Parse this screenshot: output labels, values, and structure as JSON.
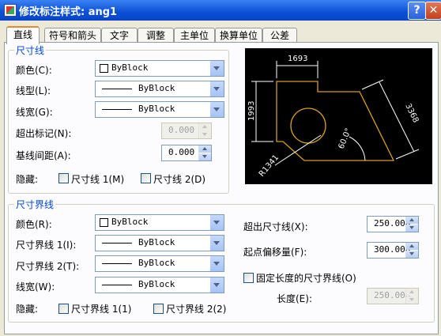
{
  "window": {
    "title": "修改标注样式: ang1",
    "help_glyph": "?",
    "close_glyph": "✕"
  },
  "tabs": [
    "直线",
    "符号和箭头",
    "文字",
    "调整",
    "主单位",
    "换算单位",
    "公差"
  ],
  "dim_lines": {
    "group_label": "尺寸线",
    "color_label": "颜色(C):",
    "color_value": "ByBlock",
    "linetype_label": "线型(L):",
    "linetype_value": "ByBlock",
    "lineweight_label": "线宽(G):",
    "lineweight_value": "ByBlock",
    "extend_ticks_label": "超出标记(N):",
    "extend_ticks_value": "0.000",
    "baseline_spacing_label": "基线间距(A):",
    "baseline_spacing_value": "0.000",
    "suppress_label": "隐藏:",
    "suppress_1": "尺寸线 1(M)",
    "suppress_2": "尺寸线 2(D)"
  },
  "ext_lines": {
    "group_label": "尺寸界线",
    "color_label": "颜色(R):",
    "color_value": "ByBlock",
    "linetype1_label": "尺寸界线 1(I):",
    "linetype1_value": "ByBlock",
    "linetype2_label": "尺寸界线 2(T):",
    "linetype2_value": "ByBlock",
    "lineweight_label": "线宽(W):",
    "lineweight_value": "ByBlock",
    "suppress_label": "隐藏:",
    "suppress_1": "尺寸界线 1(1)",
    "suppress_2": "尺寸界线 2(2)",
    "extend_beyond_label": "超出尺寸线(X):",
    "extend_beyond_value": "250.000",
    "offset_label": "起点偏移量(F):",
    "offset_value": "300.000",
    "fixed_length_label": "固定长度的尺寸界线(O)",
    "length_label": "长度(E):",
    "length_value": "250.000"
  },
  "preview": {
    "dim_top": "1693",
    "dim_left": "1993",
    "dim_right": "3368",
    "dim_angle": "60.0°",
    "dim_radius": "R1341"
  },
  "colors": {
    "title_bar": "#0a4fd6",
    "group_label": "#0046d5",
    "preview_bg": "#000000",
    "preview_shape": "#d4a020"
  }
}
